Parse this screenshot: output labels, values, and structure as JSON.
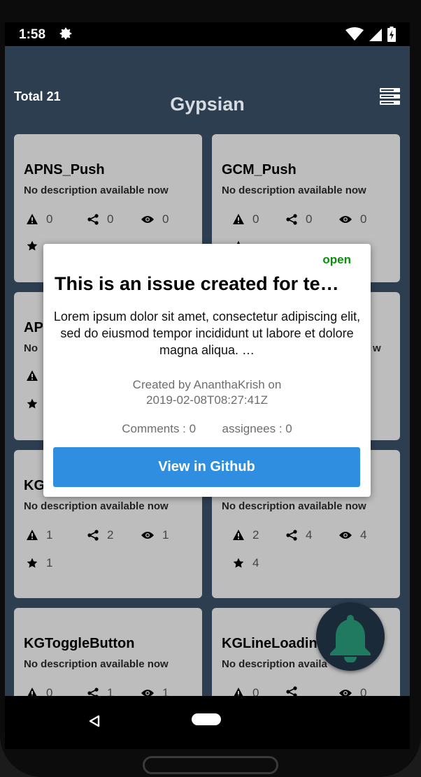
{
  "status_bar": {
    "time": "1:58"
  },
  "app_bar": {
    "total": "Total 21",
    "title": "Gypsian"
  },
  "repos": [
    {
      "name": "APNS_Push",
      "description": "No description available now",
      "issues": "0",
      "forks": "0",
      "watchers": "0",
      "stars": ""
    },
    {
      "name": "GCM_Push",
      "description": "No description available now",
      "issues": "0",
      "forks": "0",
      "watchers": "0",
      "stars": ""
    },
    {
      "name": "AP",
      "description": "No",
      "issues": "",
      "forks": "",
      "watchers": "",
      "stars": ""
    },
    {
      "name": "",
      "description": "w",
      "issues": "",
      "forks": "",
      "watchers": "",
      "stars": ""
    },
    {
      "name": "KG",
      "description": "No description available now",
      "issues": "1",
      "forks": "2",
      "watchers": "1",
      "stars": "1"
    },
    {
      "name": "",
      "description": "No description available now",
      "issues": "2",
      "forks": "4",
      "watchers": "4",
      "stars": "4"
    },
    {
      "name": "KGToggleButton",
      "description": "No description available now",
      "issues": "0",
      "forks": "1",
      "watchers": "1",
      "stars": ""
    },
    {
      "name": "KGLineLoadin",
      "description": "No description availa",
      "issues": "0",
      "forks": "",
      "watchers": "0",
      "stars": ""
    }
  ],
  "modal": {
    "status": "open",
    "title": "This is an issue created for te…",
    "body": "Lorem ipsum dolor sit amet, consectetur adipiscing elit, sed do eiusmod tempor incididunt ut labore et dolore magna aliqua. …",
    "created_line1": "Created by AnanthaKrish on",
    "created_line2": "2019-02-08T08:27:41Z",
    "comments": "Comments : 0",
    "assignees": "assignees : 0",
    "button_label": "View in Github"
  },
  "colors": {
    "app_bar": "#2c3e50",
    "card": "#bdbdbd",
    "open_status": "#0a8f0a",
    "button": "#2f8ee0",
    "bell": "#1f7a5f"
  },
  "icons": [
    "settings-gear-icon",
    "wifi-icon",
    "signal-icon",
    "battery-icon",
    "list-menu-icon",
    "warning-icon",
    "share-icon",
    "eye-icon",
    "star-icon",
    "bell-icon",
    "back-icon"
  ]
}
